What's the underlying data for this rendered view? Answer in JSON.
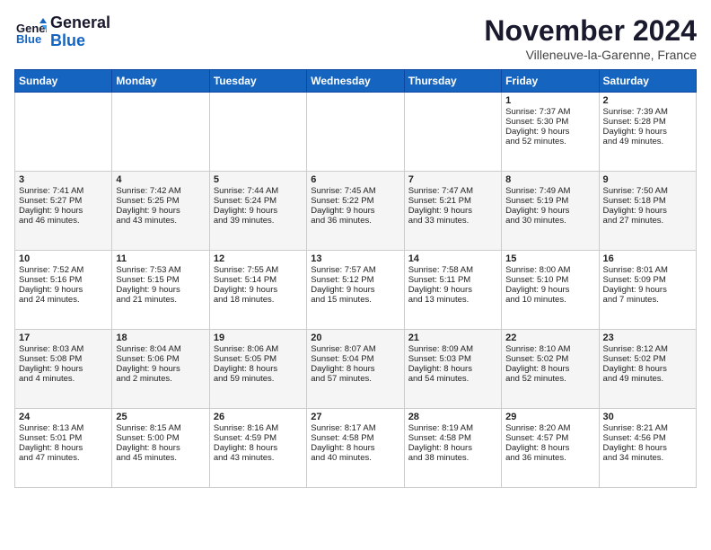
{
  "header": {
    "logo_line1": "General",
    "logo_line2": "Blue",
    "month": "November 2024",
    "location": "Villeneuve-la-Garenne, France"
  },
  "weekdays": [
    "Sunday",
    "Monday",
    "Tuesday",
    "Wednesday",
    "Thursday",
    "Friday",
    "Saturday"
  ],
  "weeks": [
    [
      {
        "day": "",
        "info": ""
      },
      {
        "day": "",
        "info": ""
      },
      {
        "day": "",
        "info": ""
      },
      {
        "day": "",
        "info": ""
      },
      {
        "day": "",
        "info": ""
      },
      {
        "day": "1",
        "info": "Sunrise: 7:37 AM\nSunset: 5:30 PM\nDaylight: 9 hours\nand 52 minutes."
      },
      {
        "day": "2",
        "info": "Sunrise: 7:39 AM\nSunset: 5:28 PM\nDaylight: 9 hours\nand 49 minutes."
      }
    ],
    [
      {
        "day": "3",
        "info": "Sunrise: 7:41 AM\nSunset: 5:27 PM\nDaylight: 9 hours\nand 46 minutes."
      },
      {
        "day": "4",
        "info": "Sunrise: 7:42 AM\nSunset: 5:25 PM\nDaylight: 9 hours\nand 43 minutes."
      },
      {
        "day": "5",
        "info": "Sunrise: 7:44 AM\nSunset: 5:24 PM\nDaylight: 9 hours\nand 39 minutes."
      },
      {
        "day": "6",
        "info": "Sunrise: 7:45 AM\nSunset: 5:22 PM\nDaylight: 9 hours\nand 36 minutes."
      },
      {
        "day": "7",
        "info": "Sunrise: 7:47 AM\nSunset: 5:21 PM\nDaylight: 9 hours\nand 33 minutes."
      },
      {
        "day": "8",
        "info": "Sunrise: 7:49 AM\nSunset: 5:19 PM\nDaylight: 9 hours\nand 30 minutes."
      },
      {
        "day": "9",
        "info": "Sunrise: 7:50 AM\nSunset: 5:18 PM\nDaylight: 9 hours\nand 27 minutes."
      }
    ],
    [
      {
        "day": "10",
        "info": "Sunrise: 7:52 AM\nSunset: 5:16 PM\nDaylight: 9 hours\nand 24 minutes."
      },
      {
        "day": "11",
        "info": "Sunrise: 7:53 AM\nSunset: 5:15 PM\nDaylight: 9 hours\nand 21 minutes."
      },
      {
        "day": "12",
        "info": "Sunrise: 7:55 AM\nSunset: 5:14 PM\nDaylight: 9 hours\nand 18 minutes."
      },
      {
        "day": "13",
        "info": "Sunrise: 7:57 AM\nSunset: 5:12 PM\nDaylight: 9 hours\nand 15 minutes."
      },
      {
        "day": "14",
        "info": "Sunrise: 7:58 AM\nSunset: 5:11 PM\nDaylight: 9 hours\nand 13 minutes."
      },
      {
        "day": "15",
        "info": "Sunrise: 8:00 AM\nSunset: 5:10 PM\nDaylight: 9 hours\nand 10 minutes."
      },
      {
        "day": "16",
        "info": "Sunrise: 8:01 AM\nSunset: 5:09 PM\nDaylight: 9 hours\nand 7 minutes."
      }
    ],
    [
      {
        "day": "17",
        "info": "Sunrise: 8:03 AM\nSunset: 5:08 PM\nDaylight: 9 hours\nand 4 minutes."
      },
      {
        "day": "18",
        "info": "Sunrise: 8:04 AM\nSunset: 5:06 PM\nDaylight: 9 hours\nand 2 minutes."
      },
      {
        "day": "19",
        "info": "Sunrise: 8:06 AM\nSunset: 5:05 PM\nDaylight: 8 hours\nand 59 minutes."
      },
      {
        "day": "20",
        "info": "Sunrise: 8:07 AM\nSunset: 5:04 PM\nDaylight: 8 hours\nand 57 minutes."
      },
      {
        "day": "21",
        "info": "Sunrise: 8:09 AM\nSunset: 5:03 PM\nDaylight: 8 hours\nand 54 minutes."
      },
      {
        "day": "22",
        "info": "Sunrise: 8:10 AM\nSunset: 5:02 PM\nDaylight: 8 hours\nand 52 minutes."
      },
      {
        "day": "23",
        "info": "Sunrise: 8:12 AM\nSunset: 5:02 PM\nDaylight: 8 hours\nand 49 minutes."
      }
    ],
    [
      {
        "day": "24",
        "info": "Sunrise: 8:13 AM\nSunset: 5:01 PM\nDaylight: 8 hours\nand 47 minutes."
      },
      {
        "day": "25",
        "info": "Sunrise: 8:15 AM\nSunset: 5:00 PM\nDaylight: 8 hours\nand 45 minutes."
      },
      {
        "day": "26",
        "info": "Sunrise: 8:16 AM\nSunset: 4:59 PM\nDaylight: 8 hours\nand 43 minutes."
      },
      {
        "day": "27",
        "info": "Sunrise: 8:17 AM\nSunset: 4:58 PM\nDaylight: 8 hours\nand 40 minutes."
      },
      {
        "day": "28",
        "info": "Sunrise: 8:19 AM\nSunset: 4:58 PM\nDaylight: 8 hours\nand 38 minutes."
      },
      {
        "day": "29",
        "info": "Sunrise: 8:20 AM\nSunset: 4:57 PM\nDaylight: 8 hours\nand 36 minutes."
      },
      {
        "day": "30",
        "info": "Sunrise: 8:21 AM\nSunset: 4:56 PM\nDaylight: 8 hours\nand 34 minutes."
      }
    ]
  ]
}
